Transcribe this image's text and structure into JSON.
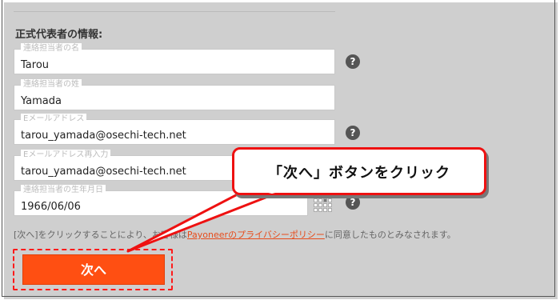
{
  "section_title": "正式代表者の情報:",
  "fields": [
    {
      "label": "連絡担当者の名",
      "value": "Tarou"
    },
    {
      "label": "連絡担当者の姓",
      "value": "Yamada"
    },
    {
      "label": "Eメールアドレス",
      "value": "tarou_yamada@osechi-tech.net"
    },
    {
      "label": "Eメールアドレス再入力",
      "value": "tarou_yamada@osechi-tech.net"
    },
    {
      "label": "連絡担当者の生年月日",
      "value": "1966/06/06"
    }
  ],
  "help_glyph": "?",
  "notice": {
    "prefix": "[次へ]をクリックすることにより、お客様は",
    "link": "Payoneerのプライバシーポリシー",
    "suffix": "に同意したものとみなされます。"
  },
  "next_button_label": "次へ",
  "callout_text": "「次へ」ボタンをクリック",
  "colors": {
    "accent": "#ff4f12",
    "annotation": "#ee1111",
    "link": "#e74c1c"
  }
}
